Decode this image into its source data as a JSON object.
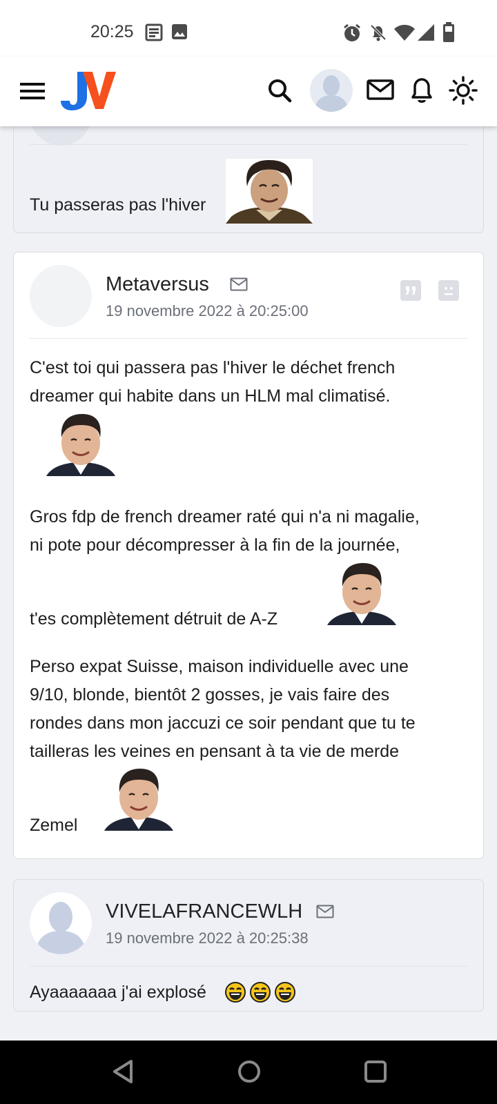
{
  "status_bar": {
    "time": "20:25",
    "left_icons": [
      "news-icon",
      "image-icon"
    ],
    "right_icons": [
      "alarm-icon",
      "bell-off-icon",
      "wifi-icon",
      "signal-icon",
      "battery-icon"
    ]
  },
  "header": {
    "logo_text": "JV",
    "icons": [
      "menu-icon",
      "search-icon",
      "user-avatar",
      "mail-icon",
      "notification-bell-icon",
      "theme-sun-icon"
    ]
  },
  "posts": [
    {
      "message": "Tu passeras pas l'hiver",
      "sticker": "laughing-man-sticker"
    },
    {
      "author": "Metaversus",
      "date": "19 novembre 2022 à 20:25:00",
      "paragraphs": [
        "C'est toi qui passera pas l'hiver le déchet french",
        "dreamer qui habite dans un HLM mal climatisé.",
        "Gros fdp de french dreamer raté qui n'a ni magalie,",
        "ni pote pour décompresser à la fin de la journée,",
        "t'es complètement détruit de A-Z",
        "Perso expat Suisse, maison individuelle avec une",
        "9/10, blonde, bientôt 2 gosses, je vais faire des",
        "rondes dans mon jaccuzi ce soir pendant que tu te",
        "tailleras les veines en pensant à ta vie de merde",
        "Zemel"
      ],
      "actions": [
        "quote-icon",
        "report-icon"
      ]
    },
    {
      "author": "VIVELAFRANCEWLH",
      "date": "19 novembre 2022 à 20:25:38",
      "message": "Ayaaaaaaa j'ai explosé",
      "emoji_count": 3
    }
  ],
  "colors": {
    "accent_blue": "#1f6fe5",
    "accent_orange": "#f5501e",
    "card_grey": "#eef0f5",
    "date_text": "#6b6f78"
  }
}
